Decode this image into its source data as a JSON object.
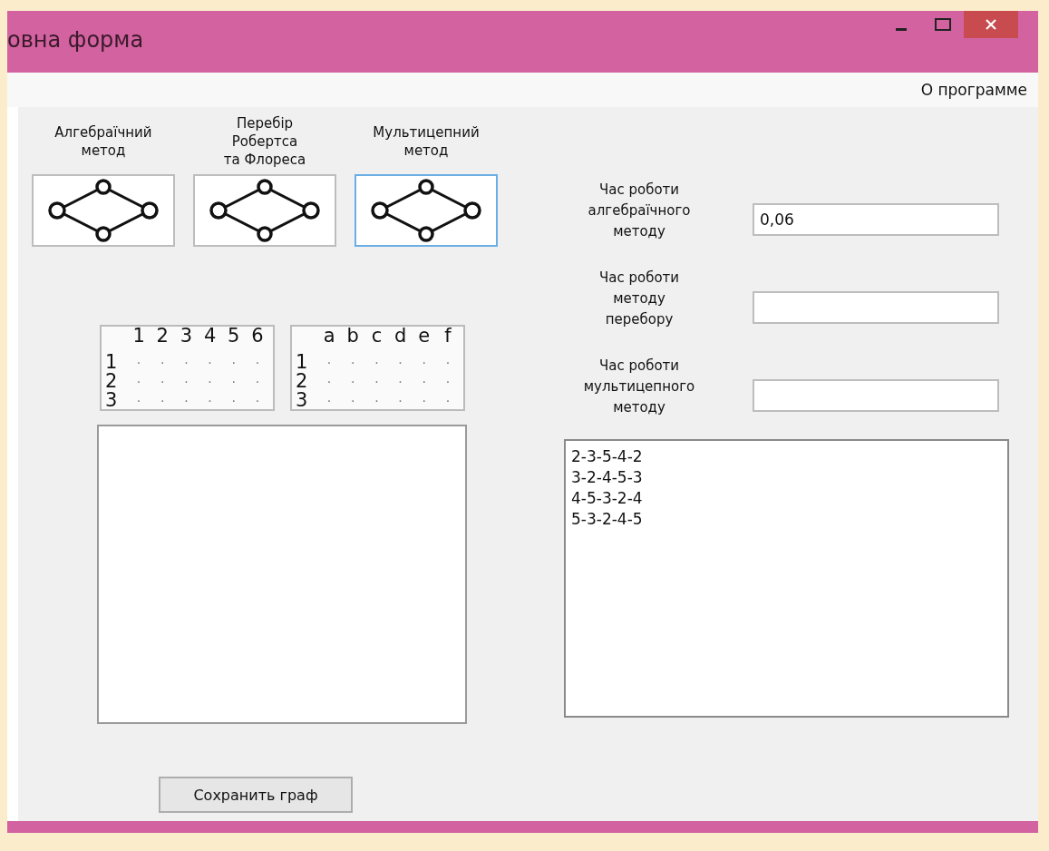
{
  "window": {
    "title": "овна форма"
  },
  "menu": [
    "О программе"
  ],
  "methods": [
    {
      "label": "Алгебраїчний\nметод",
      "selected": false
    },
    {
      "label": "Перебір\nРобертса\nта Флореса",
      "selected": false
    },
    {
      "label": "Мультицепний\nметод",
      "selected": true
    }
  ],
  "matrices": [
    {
      "columns": [
        "1",
        "2",
        "3",
        "4",
        "5",
        "6"
      ],
      "rows": [
        {
          "label": "1",
          "cells": [
            ".",
            ".",
            ".",
            ".",
            ".",
            "."
          ]
        },
        {
          "label": "2",
          "cells": [
            ".",
            ".",
            ".",
            ".",
            ".",
            "."
          ]
        },
        {
          "label": "3",
          "cells": [
            ".",
            ".",
            ".",
            ".",
            ".",
            "."
          ]
        }
      ]
    },
    {
      "columns": [
        "a",
        "b",
        "c",
        "d",
        "e",
        "f"
      ],
      "rows": [
        {
          "label": "1",
          "cells": [
            ".",
            ".",
            ".",
            ".",
            ".",
            "."
          ]
        },
        {
          "label": "2",
          "cells": [
            ".",
            ".",
            ".",
            ".",
            ".",
            "."
          ]
        },
        {
          "label": "3",
          "cells": [
            ".",
            ".",
            ".",
            ".",
            ".",
            "."
          ]
        }
      ]
    }
  ],
  "timings": [
    {
      "label": "Час роботи\nалгебраїчного\nметоду",
      "value": "0,06"
    },
    {
      "label": "Час роботи\nметоду\nперебору"
    },
    {
      "label": "Час роботи\nмультицепного\nметоду"
    }
  ],
  "results": [
    "2-3-5-4-2",
    "3-2-4-5-3",
    "4-5-3-2-4",
    "5-3-2-4-5"
  ],
  "save_button": "Сохранить граф"
}
